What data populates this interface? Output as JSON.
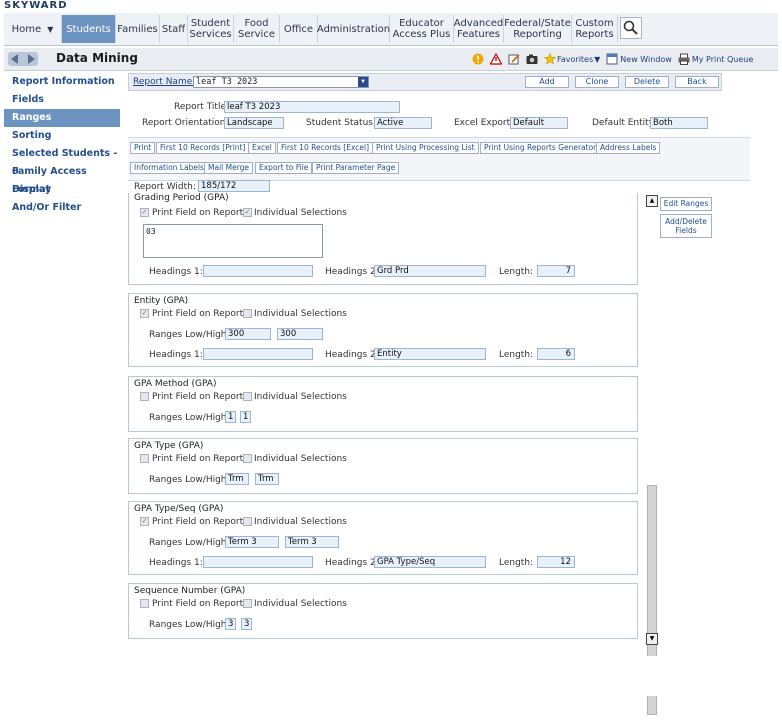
{
  "brand": "SKYWARD",
  "nav": {
    "home": "Home",
    "items": [
      "Students",
      "Families",
      "Staff",
      "Student Services",
      "Food Service",
      "Office",
      "Administration",
      "Educator Access Plus",
      "Advanced Features",
      "Federal/State Reporting",
      "Custom Reports"
    ]
  },
  "title": "Data Mining",
  "toolbar": {
    "favorites": "Favorites",
    "new_window": "New Window",
    "print_queue": "My Print Queue"
  },
  "sidebar": {
    "items": [
      "Report Information",
      "Fields",
      "Ranges",
      "Sorting",
      "Selected Students - 0",
      "Family Access Display",
      "Format",
      "And/Or Filter"
    ]
  },
  "report": {
    "name_label": "Report Name:",
    "name_value": "leaf T3 2023",
    "buttons": [
      "Add",
      "Clone",
      "Delete",
      "Back"
    ],
    "title_label": "Report Title:",
    "title_value": "leaf T3 2023",
    "orientation_label": "Report Orientation:",
    "orientation_value": "Landscape",
    "status_label": "Student Status:",
    "status_value": "Active",
    "excel_label": "Excel Export:",
    "excel_value": "Default",
    "entity_label": "Default Entity:",
    "entity_value": "Both",
    "print_buttons": [
      "Print",
      "First 10 Records [Print]",
      "Excel",
      "First 10 Records [Excel]",
      "Print Using Processing List",
      "Print Using Reports Generator",
      "Address Labels",
      "Information Labels",
      "Mail Merge",
      "Export to File",
      "Print Parameter Page"
    ],
    "width_label": "Report Width:",
    "width_value": "185/172"
  },
  "labels": {
    "print_field": "Print Field on Report",
    "individual": "Individual Selections",
    "ranges": "Ranges Low/High:",
    "h1": "Headings 1:",
    "h2": "Headings 2:",
    "length": "Length:"
  },
  "sections": [
    {
      "title": "Grading Period (GPA)",
      "textarea": "03",
      "h1": "",
      "h2": "Grd Prd",
      "length": "7"
    },
    {
      "title": "Entity (GPA)",
      "low": "300",
      "high": "300",
      "h1": "",
      "h2": "Entity",
      "length": "6"
    },
    {
      "title": "GPA Method (GPA)",
      "low": "1",
      "high": "1"
    },
    {
      "title": "GPA Type (GPA)",
      "low": "Trm",
      "high": "Trm"
    },
    {
      "title": "GPA Type/Seq (GPA)",
      "low": "Term 3",
      "high": "Term 3",
      "h1": "",
      "h2": "GPA Type/Seq",
      "length": "12"
    },
    {
      "title": "Sequence Number (GPA)",
      "low": "3",
      "high": "3"
    }
  ],
  "right_buttons": {
    "edit_ranges": "Edit Ranges",
    "add_delete_1": "Add/Delete",
    "add_delete_2": "Fields"
  },
  "colors": {
    "accent": "#6d93c1",
    "link": "#234f8e"
  }
}
